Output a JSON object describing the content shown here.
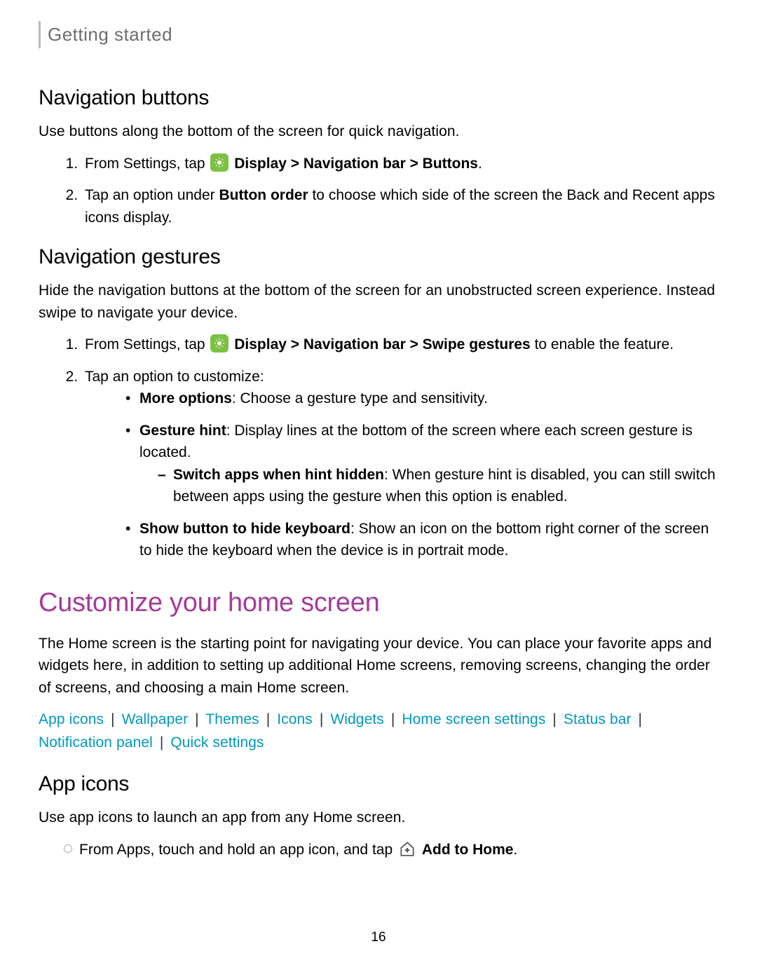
{
  "breadcrumb": "Getting started",
  "nav_buttons": {
    "heading": "Navigation buttons",
    "intro": "Use buttons along the bottom of the screen for quick navigation.",
    "step1_pre": "From Settings, tap ",
    "step1_bold": "Display > Navigation bar > Buttons",
    "step1_post": ".",
    "step2_pre": "Tap an option under ",
    "step2_bold": "Button order",
    "step2_post": " to choose which side of the screen the Back and Recent apps icons display."
  },
  "nav_gestures": {
    "heading": "Navigation gestures",
    "intro": "Hide the navigation buttons at the bottom of the screen for an unobstructed screen experience. Instead swipe to navigate your device.",
    "step1_pre": "From Settings, tap ",
    "step1_bold": "Display > Navigation bar > Swipe gestures",
    "step1_post": " to enable the feature.",
    "step2": "Tap an option to customize:",
    "opt1_bold": "More options",
    "opt1_post": ": Choose a gesture type and sensitivity.",
    "opt2_bold": "Gesture hint",
    "opt2_post": ": Display lines at the bottom of the screen where each screen gesture is located.",
    "opt2_sub_bold": "Switch apps when hint hidden",
    "opt2_sub_post": ": When gesture hint is disabled, you can still switch between apps using the gesture when this option is enabled.",
    "opt3_bold": "Show button to hide keyboard",
    "opt3_post": ": Show an icon on the bottom right corner of the screen to hide the keyboard when the device is in portrait mode."
  },
  "customize": {
    "heading": "Customize your home screen",
    "intro": "The Home screen is the starting point for navigating your device. You can place your favorite apps and widgets here, in addition to setting up additional Home screens, removing screens, changing the order of screens, and choosing a main Home screen.",
    "links": {
      "l1": "App icons",
      "l2": "Wallpaper",
      "l3": "Themes",
      "l4": "Icons",
      "l5": "Widgets",
      "l6": "Home screen settings",
      "l7": "Status bar",
      "l8": "Notification panel",
      "l9": "Quick settings"
    },
    "sep": "|"
  },
  "app_icons": {
    "heading": "App icons",
    "intro": "Use app icons to launch an app from any Home screen.",
    "step_pre": "From Apps, touch and hold an app icon, and tap ",
    "step_bold": "Add to Home",
    "step_post": "."
  },
  "page_number": "16"
}
